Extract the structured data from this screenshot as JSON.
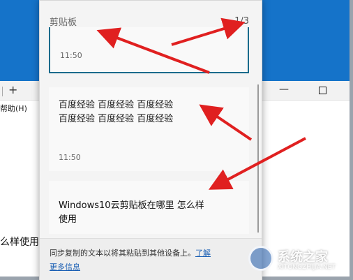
{
  "background": {
    "menu_fragment": "帮助(H)",
    "text_fragment": "么样使用",
    "plus_glyph": "+",
    "minimize_glyph": "—"
  },
  "clipboard": {
    "title": "剪贴板",
    "counter": "1/3",
    "items": [
      {
        "text_lines": [],
        "time": "11:50",
        "selected": true
      },
      {
        "text_lines": [
          "百度经验 百度经验 百度经验",
          "百度经验 百度经验 百度经验"
        ],
        "time": "11:50",
        "selected": false
      },
      {
        "text_lines": [
          "Windows10云剪贴板在哪里 怎么样",
          "使用"
        ],
        "time": "",
        "selected": false
      }
    ],
    "footer": {
      "text": "同步复制的文本以将其粘贴到其他设备上。",
      "learn_link": "了解",
      "more_info_link": "更多信息"
    }
  },
  "watermark": {
    "text": "系统之家",
    "url": "XITONGZHIJIA.NET"
  },
  "colors": {
    "desktop_blue": "#1573c9",
    "selection_border": "#1a6b8c",
    "arrow_red": "#e02020",
    "link_blue": "#1a5fb4"
  }
}
